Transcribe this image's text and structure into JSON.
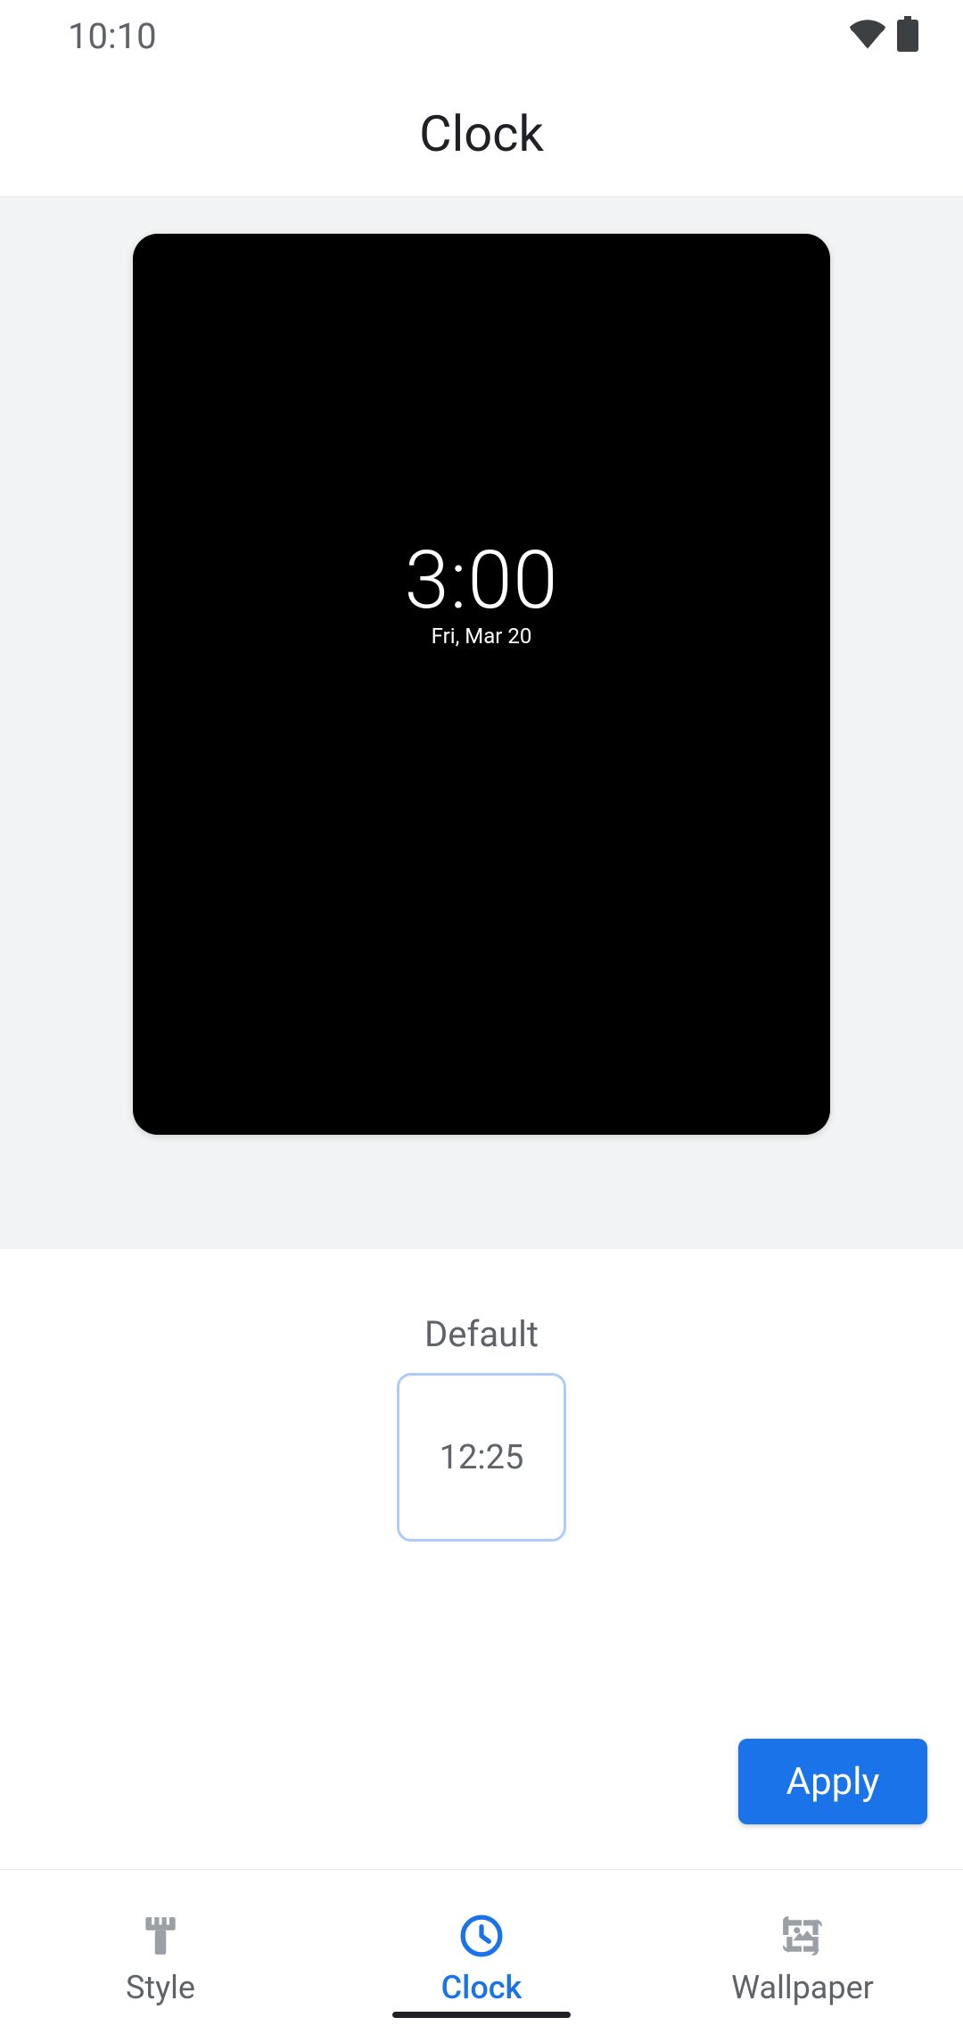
{
  "status_bar": {
    "time": "10:10"
  },
  "header": {
    "title": "Clock"
  },
  "preview": {
    "time": "3:00",
    "date": "Fri, Mar 20"
  },
  "clock_option": {
    "label": "Default",
    "thumbnail_time": "12:25"
  },
  "apply_button": "Apply",
  "bottom_nav": {
    "items": [
      {
        "label": "Style"
      },
      {
        "label": "Clock"
      },
      {
        "label": "Wallpaper"
      }
    ]
  }
}
